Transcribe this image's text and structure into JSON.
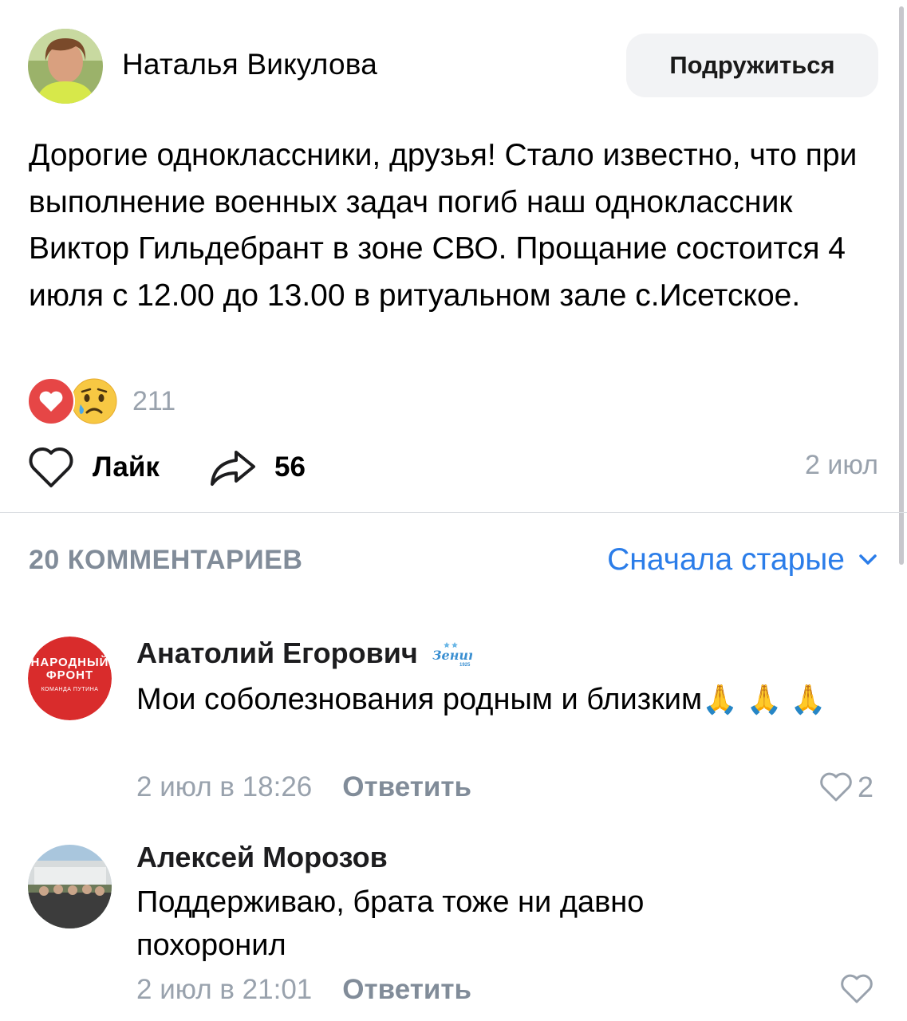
{
  "post": {
    "author": "Наталья Викулова",
    "friend_button": "Подружиться",
    "text": "Дорогие одноклассники, друзья! Стало известно, что при выполнение военных задач погиб наш одноклассник Виктор Гильдебрант в зоне СВО. Прощание состоится 4 июля с 12.00 до 13.00 в ритуальном зале с.Исетское.",
    "reactions_count": "211",
    "like_label": "Лайк",
    "share_count": "56",
    "date": "2 июл",
    "reaction_icons": [
      "heart-icon",
      "crying-face-icon"
    ]
  },
  "comments_header": {
    "count_label": "20 КОММЕНТАРИЕВ",
    "sort_label": "Сначала старые"
  },
  "comments": [
    {
      "author": "Анатолий Егорович",
      "avatar_text": [
        "НАРОДНЫЙ",
        "ФРОНТ",
        "КОМАНДА ПУТИНА"
      ],
      "badge_text": "Зенит",
      "badge_year": "1925",
      "text": "Мои соболезнования родным и близким",
      "emoji": "🙏",
      "time": "2 июл в 18:26",
      "reply_label": "Ответить",
      "likes": "2"
    },
    {
      "author": "Алексей Морозов",
      "text": "Поддерживаю, брата тоже ни давно похоронил",
      "time": "2 июл в 21:01",
      "reply_label": "Ответить",
      "likes": ""
    }
  ],
  "colors": {
    "accent": "#2b7de9",
    "secondary_text": "#99a2ad",
    "heart": "#e64646",
    "button_bg": "#f2f3f5"
  }
}
